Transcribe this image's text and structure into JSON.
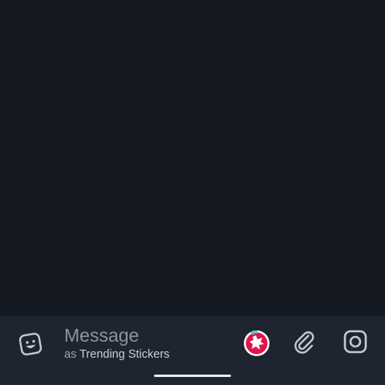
{
  "composer": {
    "placeholder": "Message",
    "as_prefix": "as",
    "bot_name": "Trending Stickers",
    "icons": {
      "emoji": "emoji-icon",
      "sticker": "trending-stickers-bot-icon",
      "attach": "paperclip-icon",
      "camera": "camera-icon"
    }
  },
  "colors": {
    "background": "#151a22",
    "composer_bg": "#1e2530",
    "icon": "#c3c8d0",
    "sticker_red": "#e0134c",
    "sticker_accent": "#3bd1c9"
  }
}
